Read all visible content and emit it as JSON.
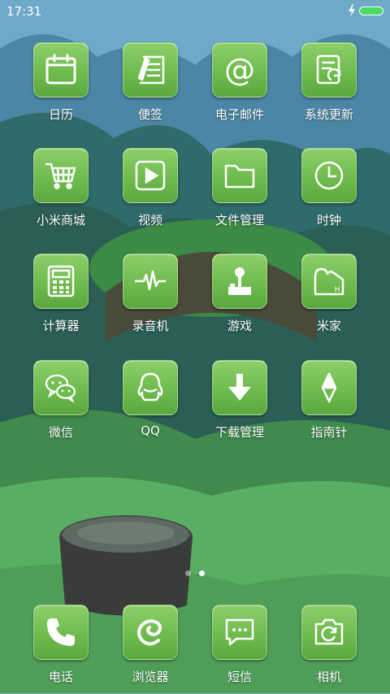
{
  "status_bar": {
    "time": "17:31",
    "battery_level": 1.0,
    "battery_color": "#4cd964",
    "charging": true
  },
  "apps": [
    {
      "label": "日历",
      "icon": "calendar-icon"
    },
    {
      "label": "便签",
      "icon": "notes-icon"
    },
    {
      "label": "电子邮件",
      "icon": "email-icon"
    },
    {
      "label": "系统更新",
      "icon": "system-update-icon"
    },
    {
      "label": "小米商城",
      "icon": "shopping-cart-icon"
    },
    {
      "label": "视频",
      "icon": "video-icon"
    },
    {
      "label": "文件管理",
      "icon": "folder-icon"
    },
    {
      "label": "时钟",
      "icon": "clock-icon"
    },
    {
      "label": "计算器",
      "icon": "calculator-icon"
    },
    {
      "label": "录音机",
      "icon": "recorder-icon"
    },
    {
      "label": "游戏",
      "icon": "joystick-icon"
    },
    {
      "label": "米家",
      "icon": "mijia-icon"
    },
    {
      "label": "微信",
      "icon": "wechat-icon"
    },
    {
      "label": "QQ",
      "icon": "qq-icon"
    },
    {
      "label": "下载管理",
      "icon": "download-icon"
    },
    {
      "label": "指南针",
      "icon": "compass-icon"
    }
  ],
  "dock": [
    {
      "label": "电话",
      "icon": "phone-icon"
    },
    {
      "label": "浏览器",
      "icon": "browser-icon"
    },
    {
      "label": "短信",
      "icon": "messages-icon"
    },
    {
      "label": "相机",
      "icon": "camera-icon"
    }
  ],
  "page_indicator": {
    "pages": 2,
    "current": 2
  },
  "colors": {
    "tile_top": "#8ccf6a",
    "tile_bottom": "#5aa83e",
    "icon_stroke": "#ffffff"
  }
}
